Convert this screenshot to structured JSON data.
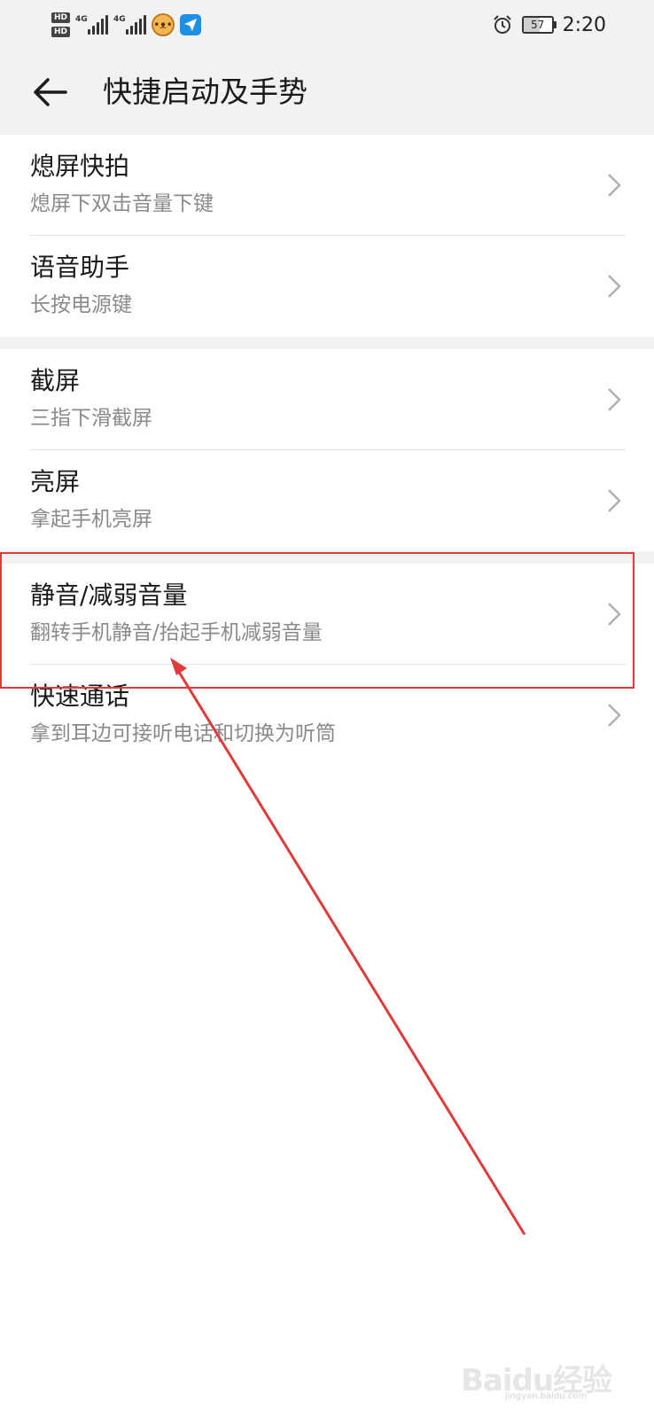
{
  "status_bar": {
    "net1": "4G",
    "net2": "4G",
    "hd1": "HD",
    "hd2": "HD",
    "battery": "57",
    "battery_level": 57,
    "time": "2:20",
    "icons": [
      "hd-icon",
      "signal-icon",
      "cat-app-icon",
      "paper-plane-icon",
      "alarm-icon",
      "battery-icon"
    ]
  },
  "header": {
    "title": "快捷启动及手势",
    "back_icon": "back-arrow-icon"
  },
  "groups": [
    {
      "items": [
        {
          "title": "熄屏快拍",
          "subtitle": "熄屏下双击音量下键"
        },
        {
          "title": "语音助手",
          "subtitle": "长按电源键"
        }
      ]
    },
    {
      "items": [
        {
          "title": "截屏",
          "subtitle": "三指下滑截屏"
        },
        {
          "title": "亮屏",
          "subtitle": "拿起手机亮屏"
        }
      ]
    },
    {
      "items": [
        {
          "title": "静音/减弱音量",
          "subtitle": "翻转手机静音/抬起手机减弱音量"
        },
        {
          "title": "快速通话",
          "subtitle": "拿到耳边可接听电话和切换为听筒"
        }
      ]
    }
  ],
  "colors": {
    "background": "#f2f2f2",
    "annotation": "#e23a3a",
    "subtitle": "#8a8a8a"
  },
  "watermark": {
    "brand": "Baidu经验",
    "url": "jingyan.baidu.com"
  }
}
